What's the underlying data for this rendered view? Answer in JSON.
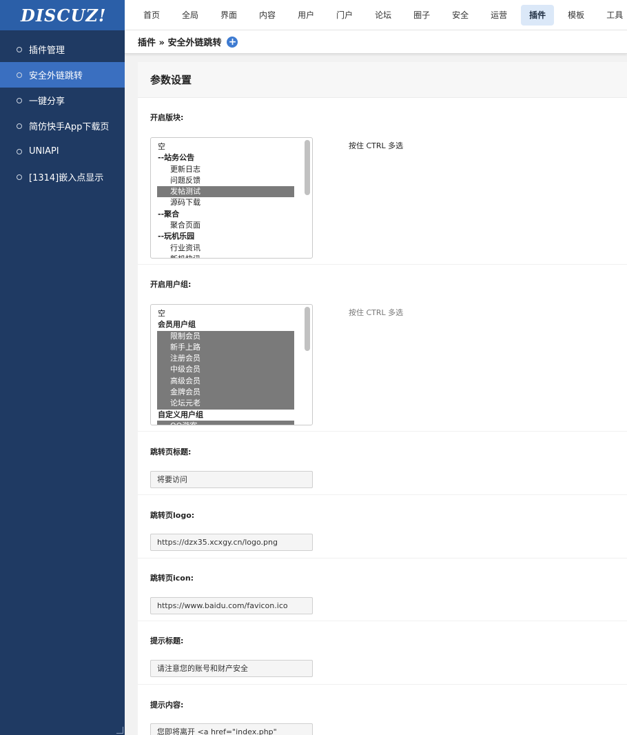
{
  "brand": {
    "logo_text": "DISCUZ!"
  },
  "sidebar": {
    "items": [
      {
        "label": "插件管理",
        "active": false
      },
      {
        "label": "安全外链跳转",
        "active": true
      },
      {
        "label": "一键分享",
        "active": false
      },
      {
        "label": "简仿快手App下载页",
        "active": false
      },
      {
        "label": "UNIAPI",
        "active": false
      },
      {
        "label": "[1314]嵌入点显示",
        "active": false
      }
    ]
  },
  "topnav": {
    "items": [
      "首页",
      "全局",
      "界面",
      "内容",
      "用户",
      "门户",
      "论坛",
      "圈子",
      "安全",
      "运营",
      "插件",
      "模板",
      "工具"
    ],
    "active_index": 10
  },
  "breadcrumb": {
    "text": "插件 » 安全外链跳转",
    "add_icon": "plus-circle-icon"
  },
  "panel": {
    "title": "参数设置"
  },
  "fields": {
    "boards": {
      "label": "开启版块:",
      "hint": "按住 CTRL 多选",
      "options": [
        {
          "text": "空",
          "type": "plain",
          "selected": false
        },
        {
          "text": "--站务公告",
          "type": "group",
          "selected": false
        },
        {
          "text": "更新日志",
          "type": "child",
          "selected": false
        },
        {
          "text": "问题反馈",
          "type": "child",
          "selected": false
        },
        {
          "text": "发帖测试",
          "type": "child",
          "selected": true
        },
        {
          "text": "源码下载",
          "type": "child",
          "selected": false
        },
        {
          "text": "--聚合",
          "type": "group",
          "selected": false
        },
        {
          "text": "聚合页面",
          "type": "child",
          "selected": false
        },
        {
          "text": "--玩机乐园",
          "type": "group",
          "selected": false
        },
        {
          "text": "行业资讯",
          "type": "child",
          "selected": false
        },
        {
          "text": "新机快讯",
          "type": "child",
          "selected": false
        }
      ]
    },
    "usergroups": {
      "label": "开启用户组:",
      "hint": "按住 CTRL 多选",
      "options": [
        {
          "text": "空",
          "type": "plain",
          "selected": false
        },
        {
          "text": "会员用户组",
          "type": "group",
          "selected": false
        },
        {
          "text": "限制会员",
          "type": "child",
          "selected": true
        },
        {
          "text": "新手上路",
          "type": "child",
          "selected": true
        },
        {
          "text": "注册会员",
          "type": "child",
          "selected": true
        },
        {
          "text": "中级会员",
          "type": "child",
          "selected": true
        },
        {
          "text": "高级会员",
          "type": "child",
          "selected": true
        },
        {
          "text": "金牌会员",
          "type": "child",
          "selected": true
        },
        {
          "text": "论坛元老",
          "type": "child",
          "selected": true
        },
        {
          "text": "自定义用户组",
          "type": "group",
          "selected": false
        },
        {
          "text": "QQ游客",
          "type": "child",
          "selected": true
        }
      ]
    },
    "page_title": {
      "label": "跳转页标题:",
      "value": "将要访问"
    },
    "page_logo": {
      "label": "跳转页logo:",
      "value": "https://dzx35.xcxgy.cn/logo.png"
    },
    "page_icon": {
      "label": "跳转页icon:",
      "value": "https://www.baidu.com/favicon.ico"
    },
    "tip_title": {
      "label": "提示标题:",
      "value": "请注意您的账号和财产安全"
    },
    "tip_content": {
      "label": "提示内容:",
      "value": "您即将离开 <a href=\"index.php\""
    }
  },
  "colors": {
    "sidebar_bg": "#1f3a63",
    "sidebar_active": "#3a6fc0",
    "logo_bar": "#2b5fa8",
    "nav_active_bg": "#dbe8f8",
    "selected_option": "#7a7a7a"
  }
}
